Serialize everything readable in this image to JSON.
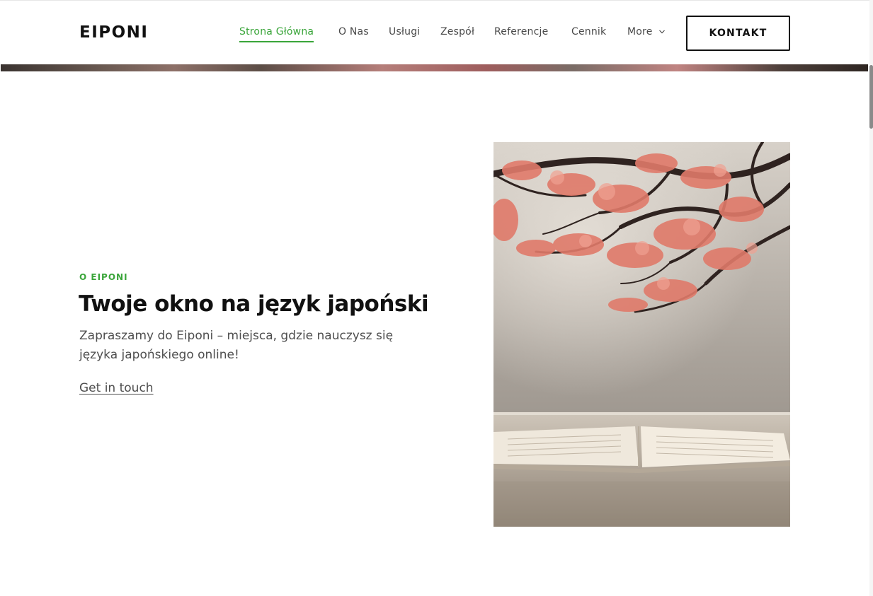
{
  "header": {
    "logo": "EIPONI",
    "nav": [
      {
        "label": "Strona Główna",
        "active": true
      },
      {
        "label": "O Nas"
      },
      {
        "label": "Usługi"
      },
      {
        "label": "Zespół"
      },
      {
        "label": "Referencje"
      },
      {
        "label": "Cennik"
      },
      {
        "label": "More",
        "icon": "chevron-down-icon"
      }
    ],
    "cta": "KONTAKT"
  },
  "hero": {
    "eyebrow": "O EIPONI",
    "title": "Twoje okno na język japoński",
    "text": "Zapraszamy do Eiponi – miejsca, gdzie nauczysz się języka japońskiego online!",
    "link": "Get in touch",
    "image_subject": "cherry blossom branches over an open book on a table"
  },
  "colors": {
    "accent": "#3aa53a",
    "text": "#111111",
    "muted": "#4e4e4e",
    "blossom": "#e07a6a"
  }
}
